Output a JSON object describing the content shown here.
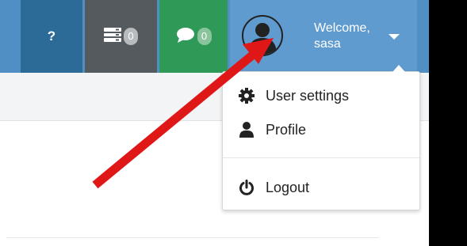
{
  "navbar": {
    "help_label": "?",
    "messages_count": "0",
    "chat_count": "0",
    "user": {
      "welcome": "Welcome,",
      "name": "sasa"
    }
  },
  "dropdown": {
    "items": [
      {
        "label": "User settings",
        "icon": "gear-icon"
      },
      {
        "label": "Profile",
        "icon": "user-icon"
      },
      {
        "label": "Logout",
        "icon": "power-icon"
      }
    ]
  },
  "colors": {
    "topbar": "#4f8fc4",
    "help": "#2c6a98",
    "messages": "#555a5f",
    "chat": "#2f9a58",
    "user": "#5f9bcf",
    "arrow": "#e01717"
  }
}
